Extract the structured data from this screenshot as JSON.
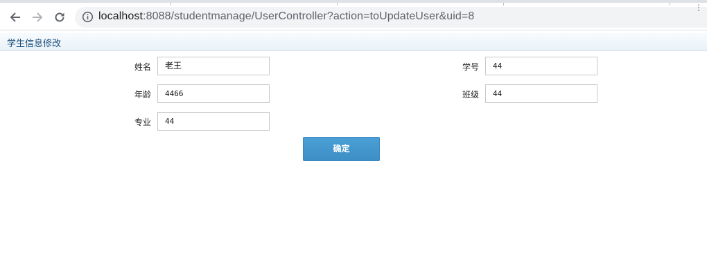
{
  "browser": {
    "url_host": "localhost",
    "url_rest": ":8088/studentmanage/UserController?action=toUpdateUser&uid=8"
  },
  "page": {
    "header_title": "学生信息修改"
  },
  "form": {
    "name_label": "姓名",
    "name_value": "老王",
    "student_id_label": "学号",
    "student_id_value": "44",
    "age_label": "年龄",
    "age_value": "4466",
    "class_label": "班级",
    "class_value": "44",
    "major_label": "专业",
    "major_value": "44",
    "submit_label": "确定"
  },
  "colors": {
    "header_text": "#1b4f78",
    "button": "#3d8ec5"
  }
}
